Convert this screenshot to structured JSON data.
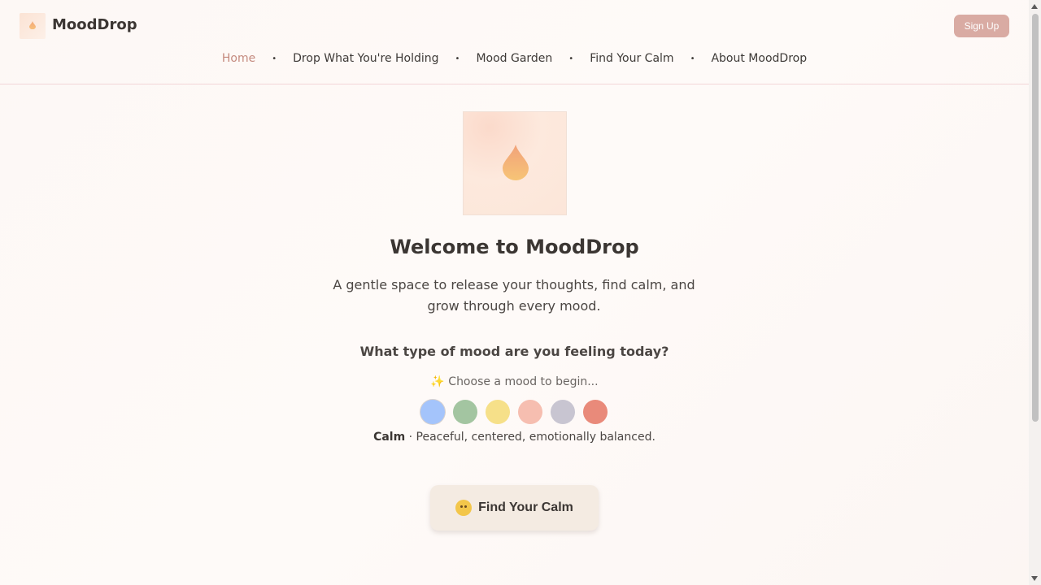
{
  "header": {
    "brand": "MoodDrop",
    "signup_label": "Sign Up"
  },
  "nav": {
    "items": [
      {
        "label": "Home",
        "active": true
      },
      {
        "label": "Drop What You're Holding",
        "active": false
      },
      {
        "label": "Mood Garden",
        "active": false
      },
      {
        "label": "Find Your Calm",
        "active": false
      },
      {
        "label": "About MoodDrop",
        "active": false
      }
    ],
    "separator": "•"
  },
  "hero": {
    "title": "Welcome to MoodDrop",
    "subtitle": "A gentle space to release your thoughts, find calm, and grow through every mood.",
    "question": "What type of mood are you feeling today?",
    "hint": "✨ Choose a mood to begin..."
  },
  "moods": {
    "colors": [
      "#a4c4fb",
      "#a3c5a1",
      "#f6e089",
      "#f6beb0",
      "#c8c5d1",
      "#e98a7a"
    ],
    "selected_index": 0,
    "selected_name": "Calm",
    "selected_separator": " · ",
    "selected_description": "Peaceful, centered, emotionally balanced."
  },
  "cta": {
    "label": "Find Your Calm",
    "icon": "hugging-face-emoji"
  },
  "colors": {
    "accent": "#d9aba3",
    "nav_active": "#c48a7e",
    "header_border": "#f3d6d8"
  }
}
